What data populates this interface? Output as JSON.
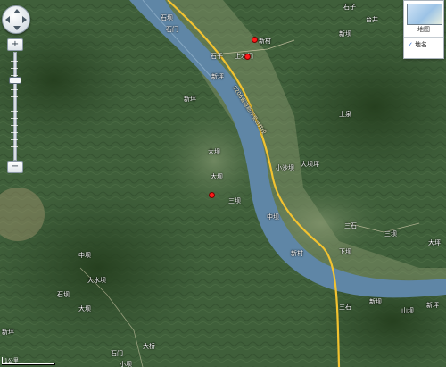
{
  "map": {
    "place_labels": [
      {
        "id": "lbl-1",
        "text": "石坝"
      },
      {
        "id": "lbl-2",
        "text": "石门"
      },
      {
        "id": "lbl-3",
        "text": "新村"
      },
      {
        "id": "lbl-4",
        "text": "石子"
      },
      {
        "id": "lbl-5",
        "text": "台井"
      },
      {
        "id": "lbl-6",
        "text": "新坝"
      },
      {
        "id": "lbl-7",
        "text": "石子"
      },
      {
        "id": "lbl-8",
        "text": "上水门"
      },
      {
        "id": "lbl-9",
        "text": "新坪"
      },
      {
        "id": "lbl-10",
        "text": "新坪"
      },
      {
        "id": "lbl-11",
        "text": "上泉"
      },
      {
        "id": "lbl-12",
        "text": "大坝"
      },
      {
        "id": "lbl-13",
        "text": "小沙坝"
      },
      {
        "id": "lbl-14",
        "text": "大坝坪"
      },
      {
        "id": "lbl-15",
        "text": "大坝"
      },
      {
        "id": "lbl-16",
        "text": "三坝"
      },
      {
        "id": "lbl-17",
        "text": "中坝"
      },
      {
        "id": "lbl-18",
        "text": "三石"
      },
      {
        "id": "lbl-19",
        "text": "三坝"
      },
      {
        "id": "lbl-20",
        "text": "大坪"
      },
      {
        "id": "lbl-21",
        "text": "新村"
      },
      {
        "id": "lbl-22",
        "text": "下坝"
      },
      {
        "id": "lbl-23",
        "text": "中坝"
      },
      {
        "id": "lbl-24",
        "text": "大水坝"
      },
      {
        "id": "lbl-25",
        "text": "石坝"
      },
      {
        "id": "lbl-26",
        "text": "大坝"
      },
      {
        "id": "lbl-27",
        "text": "新坪"
      },
      {
        "id": "lbl-28",
        "text": "新坝"
      },
      {
        "id": "lbl-29",
        "text": "山坝"
      },
      {
        "id": "lbl-30",
        "text": "三石"
      },
      {
        "id": "lbl-31",
        "text": "大桥"
      },
      {
        "id": "lbl-32",
        "text": "石门"
      },
      {
        "id": "lbl-33",
        "text": "小坝"
      },
      {
        "id": "lbl-34",
        "text": "新坪"
      }
    ],
    "road_label": "S206省道新坪至台井段",
    "markers": [
      {
        "id": "marker-1"
      },
      {
        "id": "marker-2"
      },
      {
        "id": "marker-3"
      }
    ],
    "colors": {
      "terrain_dark": "#2f4a2c",
      "terrain_mid": "#4a6a40",
      "terrain_light": "#8a9a70",
      "river": "#5f86a6",
      "road": "#f2c230",
      "marker": "#ff1a1a"
    }
  },
  "controls": {
    "nav_icon": "pan-arrows-icon",
    "zoom_in_label": "+",
    "zoom_out_label": "−",
    "zoom_level_fraction": 0.75
  },
  "map_type": {
    "thumb_label": "地图",
    "option_label": "地名",
    "option_checked": true
  },
  "scale": {
    "text": "1公里"
  }
}
